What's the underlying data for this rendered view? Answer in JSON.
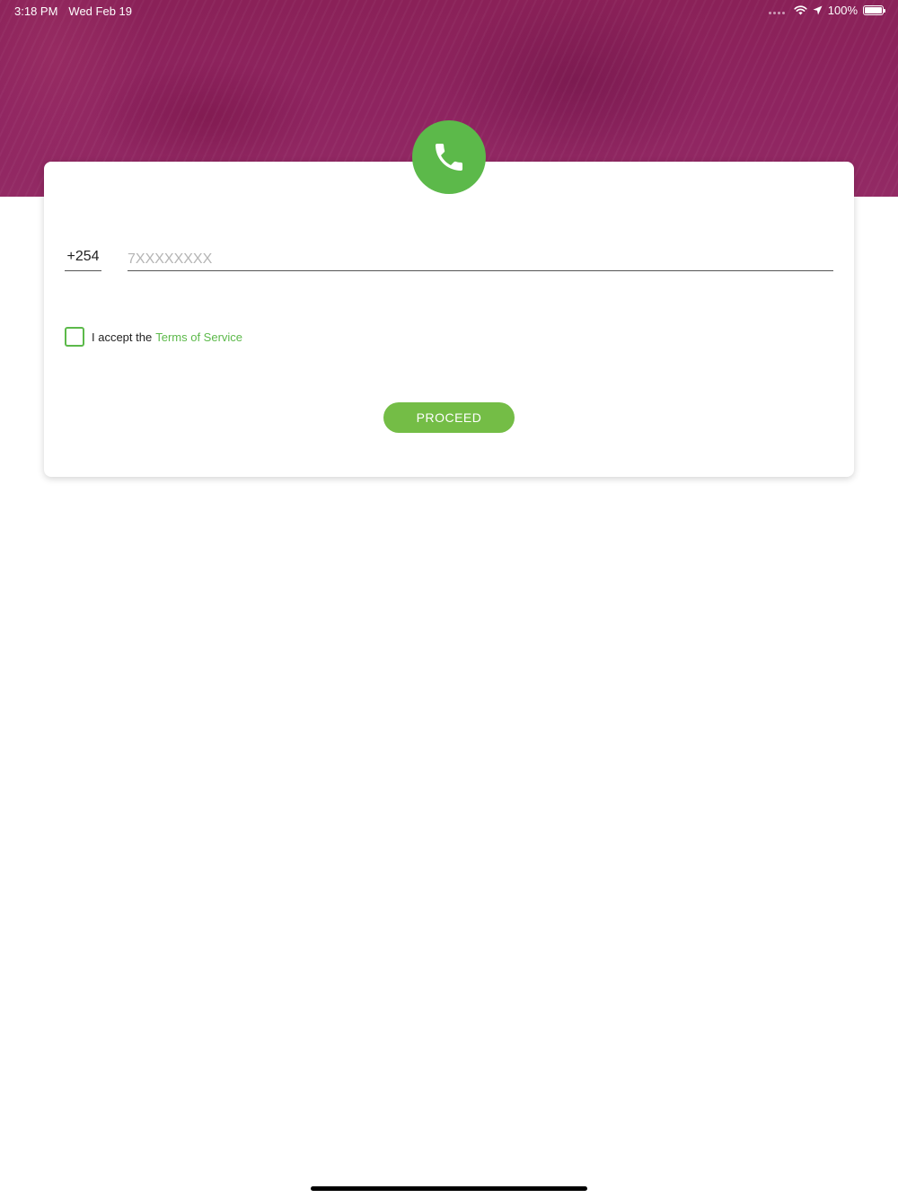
{
  "status_bar": {
    "time": "3:18 PM",
    "date": "Wed Feb 19",
    "battery": "100%",
    "battery_level": 1.0,
    "icons": [
      "signal-dots-icon",
      "wifi-icon",
      "location-arrow-icon",
      "battery-icon"
    ]
  },
  "header": {
    "icon": "phone-icon",
    "accent_color": "#8e2460"
  },
  "form": {
    "country_code": "+254",
    "phone_value": "",
    "phone_placeholder": "7XXXXXXXX",
    "terms_prefix": "I accept the",
    "terms_link": "Terms of Service",
    "terms_checked": false,
    "proceed_label": "PROCEED"
  },
  "colors": {
    "brand_green": "#5cb94a",
    "button_green": "#74bd46",
    "header_magenta": "#8e2460"
  }
}
